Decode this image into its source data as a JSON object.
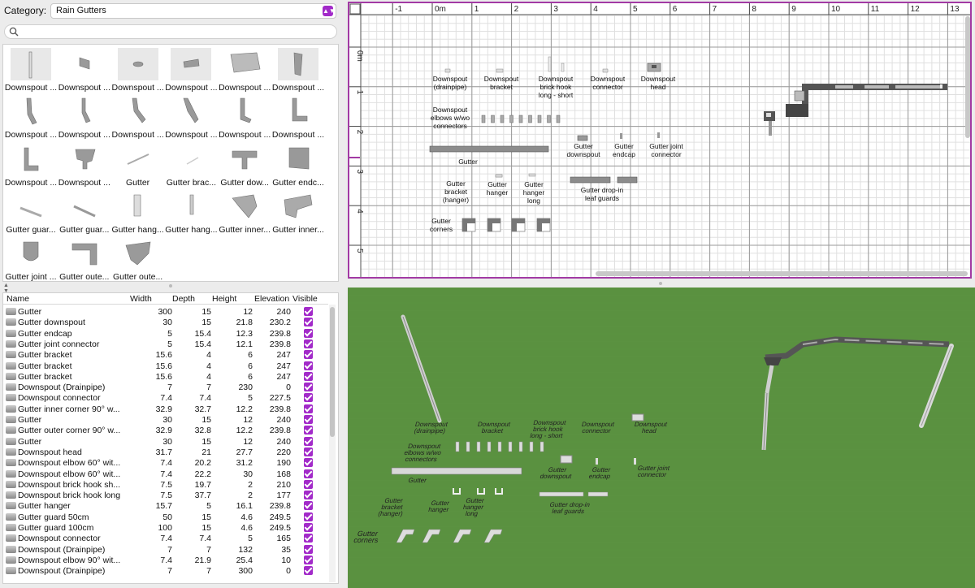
{
  "category": {
    "label": "Category:",
    "value": "Rain Gutters"
  },
  "search": {
    "placeholder": ""
  },
  "catalog": [
    "Downspout ...",
    "Downspout ...",
    "Downspout ...",
    "Downspout ...",
    "Downspout ...",
    "Downspout ...",
    "Downspout ...",
    "Downspout ...",
    "Downspout ...",
    "Downspout ...",
    "Downspout ...",
    "Downspout ...",
    "Downspout ...",
    "Downspout ...",
    "Gutter",
    "Gutter brac...",
    "Gutter dow...",
    "Gutter endc...",
    "Gutter guar...",
    "Gutter guar...",
    "Gutter hang...",
    "Gutter hang...",
    "Gutter inner...",
    "Gutter inner...",
    "Gutter joint ...",
    "Gutter oute...",
    "Gutter oute..."
  ],
  "table": {
    "headers": {
      "name": "Name",
      "width": "Width",
      "depth": "Depth",
      "height": "Height",
      "elevation": "Elevation",
      "visible": "Visible"
    },
    "rows": [
      {
        "name": "Gutter",
        "width": "300",
        "depth": "15",
        "height": "12",
        "elevation": "240"
      },
      {
        "name": "Gutter downspout",
        "width": "30",
        "depth": "15",
        "height": "21.8",
        "elevation": "230.2"
      },
      {
        "name": "Gutter endcap",
        "width": "5",
        "depth": "15.4",
        "height": "12.3",
        "elevation": "239.8"
      },
      {
        "name": "Gutter joint connector",
        "width": "5",
        "depth": "15.4",
        "height": "12.1",
        "elevation": "239.8"
      },
      {
        "name": "Gutter bracket",
        "width": "15.6",
        "depth": "4",
        "height": "6",
        "elevation": "247"
      },
      {
        "name": "Gutter bracket",
        "width": "15.6",
        "depth": "4",
        "height": "6",
        "elevation": "247"
      },
      {
        "name": "Gutter bracket",
        "width": "15.6",
        "depth": "4",
        "height": "6",
        "elevation": "247"
      },
      {
        "name": "Downspout (Drainpipe)",
        "width": "7",
        "depth": "7",
        "height": "230",
        "elevation": "0"
      },
      {
        "name": "Downspout connector",
        "width": "7.4",
        "depth": "7.4",
        "height": "5",
        "elevation": "227.5"
      },
      {
        "name": "Gutter inner corner 90° w...",
        "width": "32.9",
        "depth": "32.7",
        "height": "12.2",
        "elevation": "239.8"
      },
      {
        "name": "Gutter",
        "width": "30",
        "depth": "15",
        "height": "12",
        "elevation": "240"
      },
      {
        "name": "Gutter outer corner 90° w...",
        "width": "32.9",
        "depth": "32.8",
        "height": "12.2",
        "elevation": "239.8"
      },
      {
        "name": "Gutter",
        "width": "30",
        "depth": "15",
        "height": "12",
        "elevation": "240"
      },
      {
        "name": "Downspout head",
        "width": "31.7",
        "depth": "21",
        "height": "27.7",
        "elevation": "220"
      },
      {
        "name": "Downspout elbow 60° wit...",
        "width": "7.4",
        "depth": "20.2",
        "height": "31.2",
        "elevation": "190"
      },
      {
        "name": "Downspout elbow 60° wit...",
        "width": "7.4",
        "depth": "22.2",
        "height": "30",
        "elevation": "168"
      },
      {
        "name": "Downspout brick hook sh...",
        "width": "7.5",
        "depth": "19.7",
        "height": "2",
        "elevation": "210"
      },
      {
        "name": "Downspout brick hook long",
        "width": "7.5",
        "depth": "37.7",
        "height": "2",
        "elevation": "177"
      },
      {
        "name": "Gutter hanger",
        "width": "15.7",
        "depth": "5",
        "height": "16.1",
        "elevation": "239.8"
      },
      {
        "name": "Gutter guard 50cm",
        "width": "50",
        "depth": "15",
        "height": "4.6",
        "elevation": "249.5"
      },
      {
        "name": "Gutter guard 100cm",
        "width": "100",
        "depth": "15",
        "height": "4.6",
        "elevation": "249.5"
      },
      {
        "name": "Downspout connector",
        "width": "7.4",
        "depth": "7.4",
        "height": "5",
        "elevation": "165"
      },
      {
        "name": "Downspout (Drainpipe)",
        "width": "7",
        "depth": "7",
        "height": "132",
        "elevation": "35"
      },
      {
        "name": "Downspout elbow 90° wit...",
        "width": "7.4",
        "depth": "21.9",
        "height": "25.4",
        "elevation": "10"
      },
      {
        "name": "Downspout (Drainpipe)",
        "width": "7",
        "depth": "7",
        "height": "300",
        "elevation": "0"
      }
    ]
  },
  "plan": {
    "ruler_x": [
      "-1",
      "0m",
      "1",
      "2",
      "3",
      "4",
      "5",
      "6",
      "7",
      "8",
      "9",
      "10",
      "11",
      "12",
      "13"
    ],
    "ruler_y": [
      "0m",
      "1",
      "2",
      "3",
      "4",
      "5"
    ],
    "labels": {
      "drainpipe": [
        "Downspout",
        "(drainpipe)"
      ],
      "bracket": [
        "Downspout",
        "bracket"
      ],
      "brickhook": [
        "Downspout",
        "brick hook",
        "long - short"
      ],
      "connector": [
        "Downspout",
        "connector"
      ],
      "head": [
        "Downspout",
        "head"
      ],
      "elbows": [
        "Downspout",
        "elbows w/wo",
        "connectors"
      ],
      "gdownspout": [
        "Gutter",
        "downspout"
      ],
      "endcap": [
        "Gutter",
        "endcap"
      ],
      "joint": [
        "Gutter joint",
        "connector"
      ],
      "gutter": [
        "Gutter"
      ],
      "gbracket": [
        "Gutter",
        "bracket",
        "(hanger)"
      ],
      "ghanger": [
        "Gutter",
        "hanger"
      ],
      "ghangerlong": [
        "Gutter",
        "hanger",
        "long"
      ],
      "leafguards": [
        "Gutter drop-in",
        "leaf guards"
      ],
      "corners": [
        "Gutter",
        "corners"
      ]
    }
  },
  "colors": {
    "accent": "#a22ac9",
    "plan_border": "#a23aa4",
    "ground": "#5a9140"
  }
}
